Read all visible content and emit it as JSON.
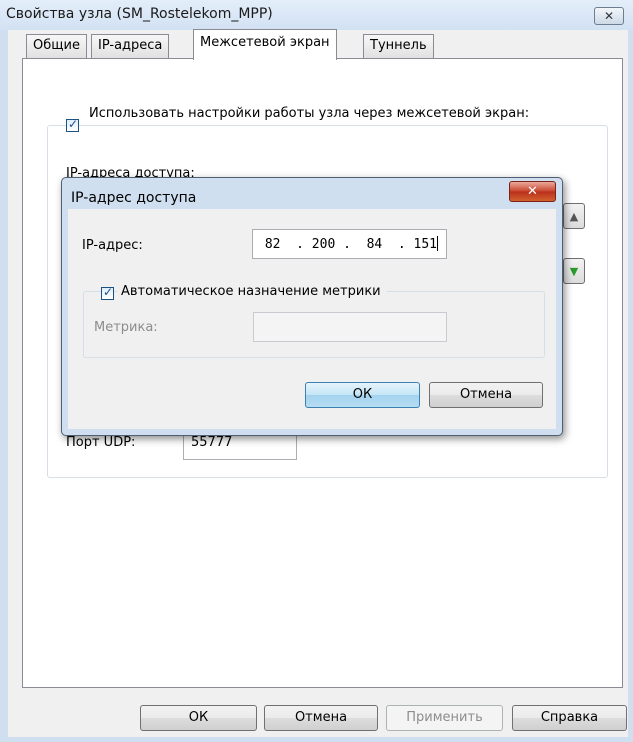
{
  "window": {
    "title": "Свойства узла (SM_Rostelekom_MPP)"
  },
  "tabs": [
    {
      "label": "Общие"
    },
    {
      "label": "IP-адреса"
    },
    {
      "label": "Межсетевой экран",
      "active": true
    },
    {
      "label": "Туннель"
    }
  ],
  "firewall": {
    "use_settings_checked": true,
    "use_settings_label": "Использовать настройки работы узла через межсетевой экран:",
    "access_addresses_label": "IP-адреса доступа:",
    "udp_port_label": "Порт UDP:",
    "udp_port_value": "55777"
  },
  "footer": {
    "ok": "ОК",
    "cancel": "Отмена",
    "apply": "Применить",
    "help": "Справка"
  },
  "dialog": {
    "title": "IP-адрес доступа",
    "ip_label": "IP-адрес:",
    "ip_value": " 82  . 200 .  84  . 151",
    "auto_metric_checked": true,
    "auto_metric_label": "Автоматическое назначение метрики",
    "metric_label": "Метрика:",
    "metric_value": "",
    "ok": "ОК",
    "cancel": "Отмена"
  },
  "colors": {
    "window_frame": "#cfdff0",
    "dialog_close": "#c8432b",
    "default_button": "#a4d3ef"
  }
}
